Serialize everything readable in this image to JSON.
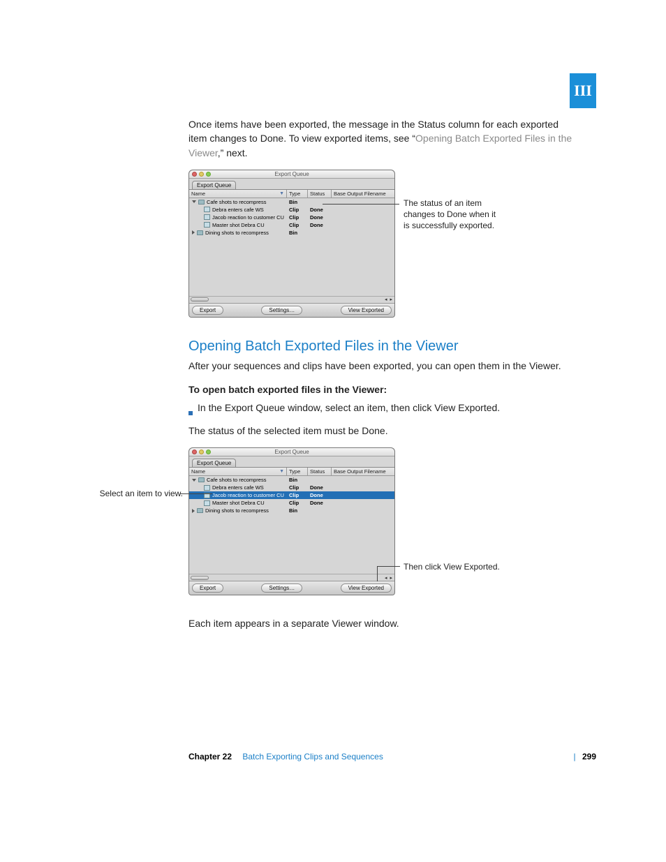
{
  "sideMarker": "III",
  "para1_a": "Once items have been exported, the message in the Status column for each exported item changes to Done. To view exported items, see “",
  "para1_link": "Opening Batch Exported Files in the Viewer",
  "para1_b": ",” next.",
  "callout1_l1": "The status of an item",
  "callout1_l2": "changes to Done when it",
  "callout1_l3": "is successfully exported.",
  "h2": "Opening Batch Exported Files in the Viewer",
  "para2": "After your sequences and clips have been exported, you can open them in the Viewer.",
  "subhead": "To open batch exported files in the Viewer:",
  "bullet1": "In the Export Queue window, select an item, then click View Exported.",
  "para3": "The status of the selected item must be Done.",
  "callout2": "Select an item to view.",
  "callout3": "Then click View Exported.",
  "para4": "Each item appears in a separate Viewer window.",
  "footer": {
    "chapter": "Chapter 22",
    "title": "Batch Exporting Clips and Sequences",
    "page": "299"
  },
  "win": {
    "title": "Export Queue",
    "tab": "Export Queue",
    "cols": {
      "name": "Name",
      "type": "Type",
      "status": "Status",
      "base": "Base Output Filename"
    },
    "rows": [
      {
        "kind": "bin-open",
        "name": "Cafe shots to recompress",
        "type": "Bin",
        "status": ""
      },
      {
        "kind": "clip",
        "name": "Debra enters cafe WS",
        "type": "Clip",
        "status": "Done"
      },
      {
        "kind": "clip",
        "name": "Jacob reaction to customer CU",
        "type": "Clip",
        "status": "Done"
      },
      {
        "kind": "clip",
        "name": "Master shot Debra CU",
        "type": "Clip",
        "status": "Done"
      },
      {
        "kind": "bin-close",
        "name": "Dining shots to recompress",
        "type": "Bin",
        "status": ""
      }
    ],
    "buttons": {
      "export": "Export",
      "settings": "Settings…",
      "view": "View Exported"
    }
  }
}
